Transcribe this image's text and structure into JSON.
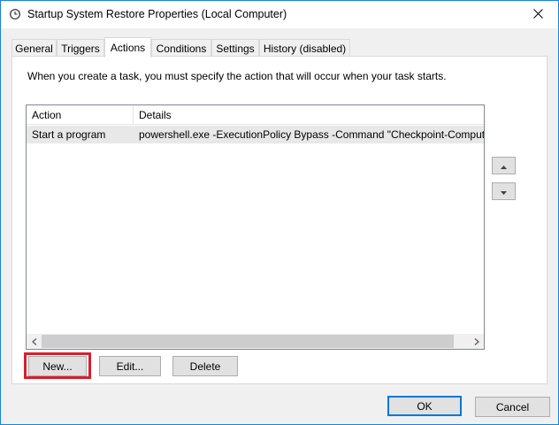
{
  "window": {
    "title": "Startup System Restore Properties (Local Computer)",
    "icon": "clock-icon",
    "close_glyph": "✕"
  },
  "tabs": [
    {
      "label": "General",
      "active": false
    },
    {
      "label": "Triggers",
      "active": false
    },
    {
      "label": "Actions",
      "active": true
    },
    {
      "label": "Conditions",
      "active": false
    },
    {
      "label": "Settings",
      "active": false
    },
    {
      "label": "History (disabled)",
      "active": false
    }
  ],
  "actions_tab": {
    "instructions": "When you create a task, you must specify the action that will occur when your task starts.",
    "table": {
      "columns": [
        "Action",
        "Details"
      ],
      "rows": [
        {
          "action": "Start a program",
          "details": "powershell.exe -ExecutionPolicy Bypass -Command \"Checkpoint-Comput"
        }
      ]
    },
    "buttons": {
      "new": "New...",
      "edit": "Edit...",
      "delete": "Delete"
    }
  },
  "footer": {
    "ok": "OK",
    "cancel": "Cancel"
  },
  "colors": {
    "highlight": "#d81f2d",
    "accent": "#0078d7"
  }
}
